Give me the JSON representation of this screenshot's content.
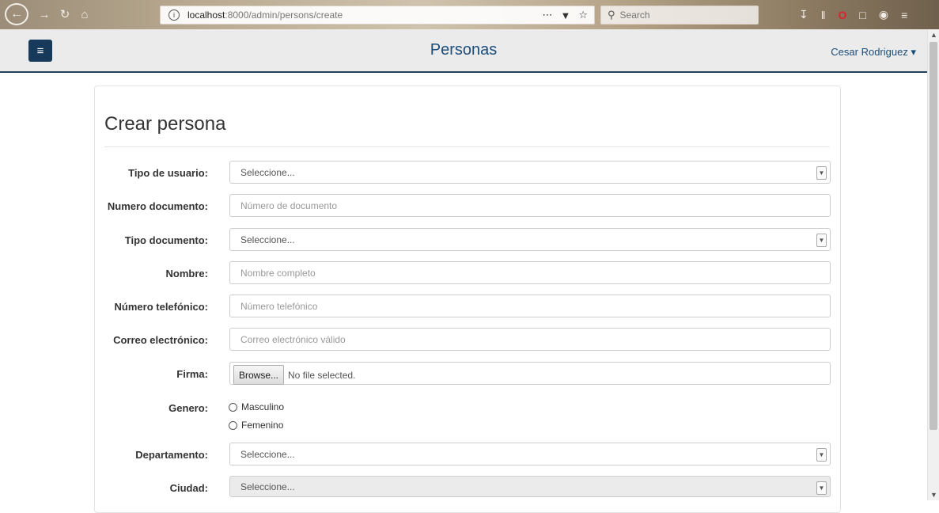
{
  "browser": {
    "url_host": "localhost",
    "url_path": ":8000/admin/persons/create",
    "search_placeholder": "Search"
  },
  "header": {
    "title": "Personas",
    "user_name": "Cesar Rodriguez"
  },
  "page": {
    "heading": "Crear persona"
  },
  "form": {
    "tipo_usuario": {
      "label": "Tipo de usuario:",
      "value": "Seleccione..."
    },
    "numero_documento": {
      "label": "Numero documento:",
      "placeholder": "Número de documento"
    },
    "tipo_documento": {
      "label": "Tipo documento:",
      "value": "Seleccione..."
    },
    "nombre": {
      "label": "Nombre:",
      "placeholder": "Nombre completo"
    },
    "telefono": {
      "label": "Número telefónico:",
      "placeholder": "Número telefónico"
    },
    "correo": {
      "label": "Correo electrónico:",
      "placeholder": "Correo electrónico válido"
    },
    "firma": {
      "label": "Firma:",
      "button": "Browse...",
      "status": "No file selected."
    },
    "genero": {
      "label": "Genero:",
      "options": [
        "Masculino",
        "Femenino"
      ]
    },
    "departamento": {
      "label": "Departamento:",
      "value": "Seleccione..."
    },
    "ciudad": {
      "label": "Ciudad:",
      "value": "Seleccione..."
    }
  },
  "colors": {
    "primary": "#173a5a",
    "title_blue": "#1b4d7a",
    "header_bg": "#ebebeb"
  }
}
